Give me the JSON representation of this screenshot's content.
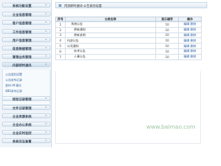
{
  "sidebar": {
    "items": [
      {
        "label": "系统功能设置"
      },
      {
        "label": "企业信息管理"
      },
      {
        "label": "客户信息管理"
      },
      {
        "label": "工作信息管理"
      },
      {
        "label": "用户信息管理"
      },
      {
        "label": "信息数据管理"
      },
      {
        "label": "管理业务管理"
      },
      {
        "label": "内部即时通讯"
      },
      {
        "label": "短信记录管理"
      },
      {
        "label": "文件记录管理"
      },
      {
        "label": "企业资源系统"
      },
      {
        "label": "企业办公系统"
      },
      {
        "label": "企业实时监控"
      },
      {
        "label": "系统日志查看"
      }
    ],
    "subitems": [
      {
        "label": "公告类别设置"
      },
      {
        "label": "公告发布记录"
      },
      {
        "label": "即时 IM 聊天"
      },
      {
        "label": "BBS发布记录"
      }
    ]
  },
  "breadcrumb": "内部即时通讯-公告类别设置",
  "table": {
    "headers": [
      "序号",
      "分类名称",
      "显示顺序",
      "操作"
    ],
    "rows": [
      {
        "no": "1",
        "name": "系统公告",
        "order": "10",
        "edit": "编辑",
        "del": "删除"
      },
      {
        "no": "2",
        "name": "更新通知",
        "order": "10",
        "edit": "编辑",
        "del": "删除"
      },
      {
        "no": "3",
        "name": "更新说明",
        "order": "10",
        "edit": "编辑",
        "del": "删除"
      },
      {
        "no": "4",
        "name": "内部公告",
        "order": "10",
        "edit": "编辑",
        "del": "删除"
      },
      {
        "no": "5",
        "name": "公司通知",
        "order": "10",
        "edit": "编辑",
        "del": "删除"
      },
      {
        "no": "6",
        "name": "技术公告",
        "order": "10",
        "edit": "编辑",
        "del": "删除"
      },
      {
        "no": "7",
        "name": "人事公告",
        "order": "10",
        "edit": "编辑",
        "del": "删除"
      }
    ]
  },
  "watermark": "www.baimao.com"
}
